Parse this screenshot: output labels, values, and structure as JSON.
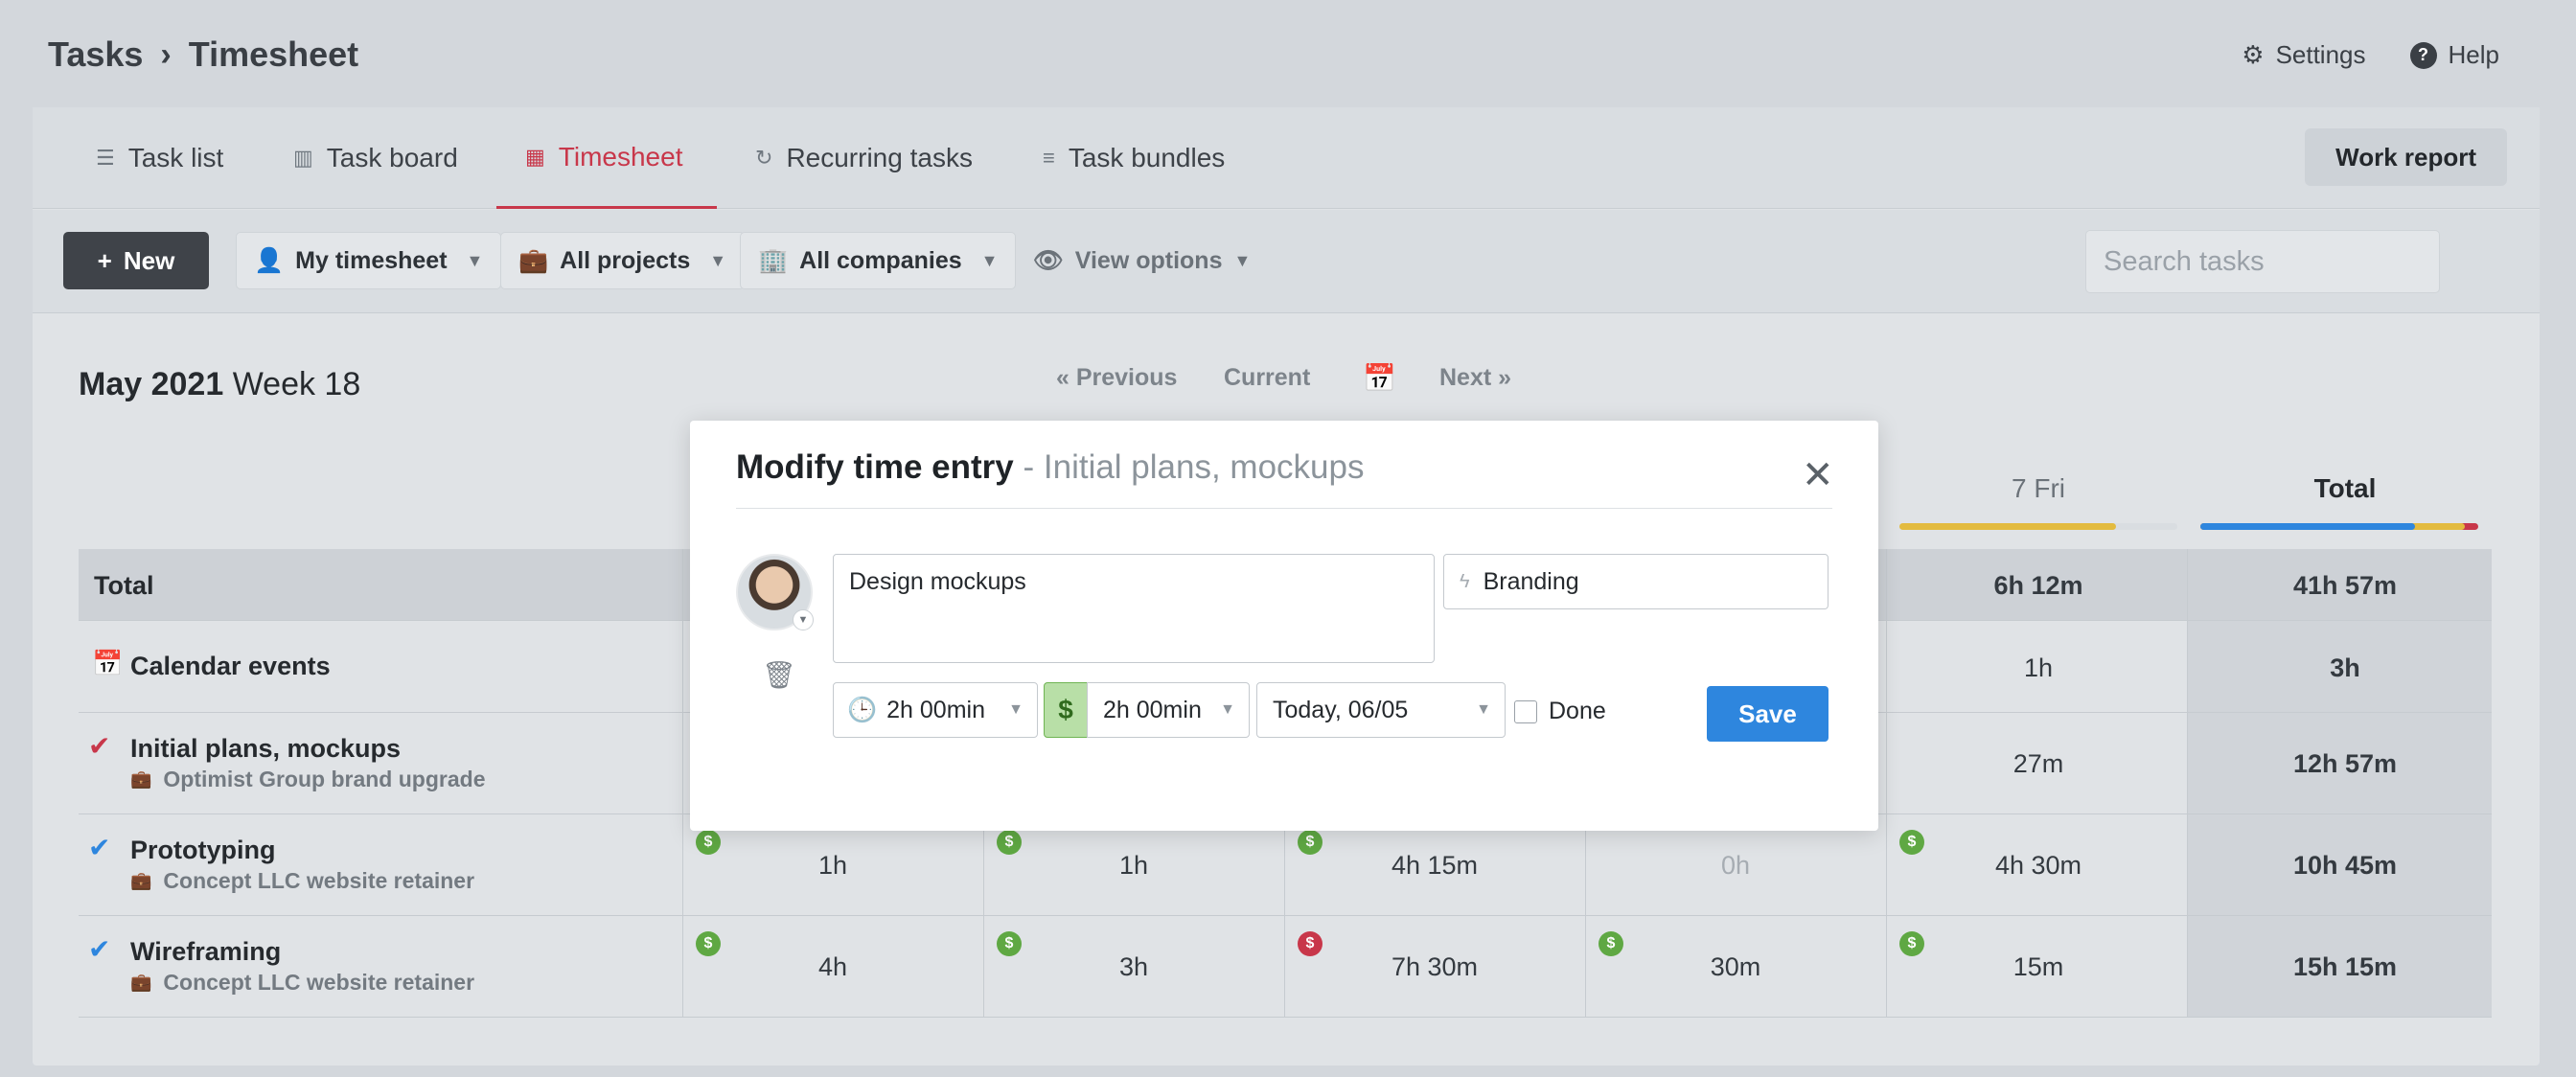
{
  "breadcrumb": {
    "parent": "Tasks",
    "separator": "›",
    "current": "Timesheet"
  },
  "top_links": {
    "settings": "Settings",
    "help": "Help"
  },
  "tabs": [
    {
      "label": "Task list",
      "icon": "list-icon"
    },
    {
      "label": "Task board",
      "icon": "board-icon"
    },
    {
      "label": "Timesheet",
      "icon": "grid-icon",
      "active": true
    },
    {
      "label": "Recurring tasks",
      "icon": "refresh-icon"
    },
    {
      "label": "Task bundles",
      "icon": "stack-icon"
    }
  ],
  "work_report_label": "Work report",
  "toolbar": {
    "new_label": "New",
    "my_timesheet": "My timesheet",
    "all_projects": "All projects",
    "all_companies": "All companies",
    "view_options": "View options",
    "search_placeholder": "Search tasks"
  },
  "week": {
    "month_year": "May 2021",
    "week_label": "Week 18"
  },
  "nav": {
    "previous": "« Previous",
    "current": "Current",
    "next": "Next »"
  },
  "columns": {
    "fri": "7 Fri",
    "total": "Total"
  },
  "table": {
    "total_row": {
      "label": "Total",
      "fri": "6h 12m",
      "total": "41h 57m"
    },
    "calendar_row": {
      "label": "Calendar events",
      "fri": "1h",
      "total": "3h"
    },
    "initial_row": {
      "label": "Initial plans, mockups",
      "sub": "Optimist Group brand upgrade",
      "fri": "27m",
      "total": "12h 57m"
    },
    "proto_row": {
      "label": "Prototyping",
      "sub": "Concept LLC website retainer",
      "d1": "1h",
      "d2": "1h",
      "d3": "4h 15m",
      "d4": "0h",
      "fri": "4h 30m",
      "total": "10h 45m"
    },
    "wire_row": {
      "label": "Wireframing",
      "sub": "Concept LLC website retainer",
      "d1": "4h",
      "d2": "3h",
      "d3": "7h 30m",
      "d4": "30m",
      "fri": "15m",
      "total": "15h 15m"
    }
  },
  "modal": {
    "title": "Modify time entry",
    "subtitle": "- Initial plans, mockups",
    "description": "Design mockups",
    "project": "Branding",
    "duration": "2h 00min",
    "billable_symbol": "$",
    "billable": "2h 00min",
    "date": "Today, 06/05",
    "done_label": "Done",
    "save_label": "Save"
  },
  "colors": {
    "accent": "#c8374a",
    "save": "#2e86de",
    "billable": "#5fa843"
  }
}
